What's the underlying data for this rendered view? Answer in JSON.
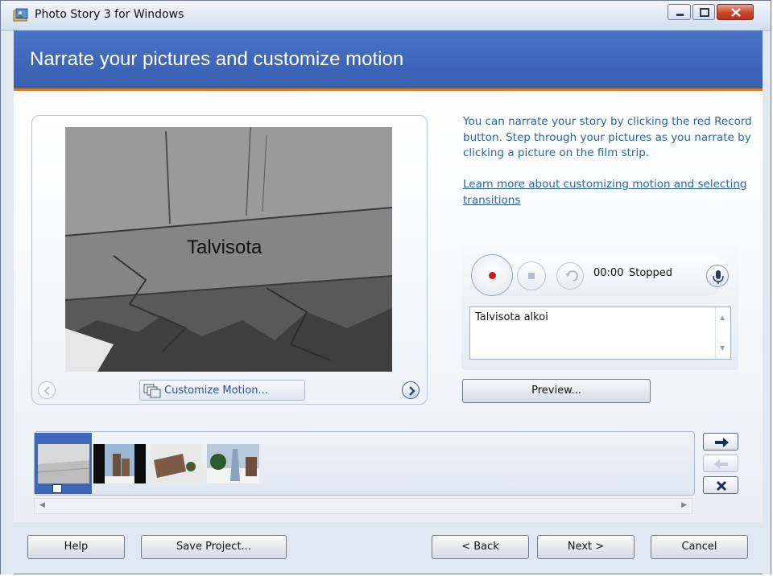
{
  "window": {
    "title": "Photo Story 3 for Windows",
    "icon": "photo-story-app-icon",
    "controls": [
      "minimize-icon",
      "maximize-icon",
      "close-icon"
    ],
    "close_color": "#c9452b"
  },
  "header": {
    "title": "Narrate your pictures and customize motion",
    "accent_color": "#e37a21",
    "background_color": "#3f67b9"
  },
  "preview": {
    "caption": "Talvisota",
    "prev_icon": "chevron-left-icon",
    "next_icon": "chevron-right-icon",
    "customize_label": "Customize Motion...",
    "customize_icon": "customize-motion-icon"
  },
  "info": {
    "text": "You can narrate your story by clicking the red Record button. Step through your pictures as you narrate by clicking a picture on the film strip.",
    "link": "Learn more about customizing motion and selecting transitions"
  },
  "recorder": {
    "time": "00:00",
    "status": "Stopped",
    "record_icon": "record-icon",
    "stop_icon": "stop-icon",
    "undo_icon": "undo-icon",
    "mic_icon": "microphone-icon",
    "notes_text": "Talvisota alkoi"
  },
  "preview_button": "Preview...",
  "filmstrip": {
    "selected_index": 0,
    "thumbnails": [
      "stone-wall-thumbnail",
      "memorial-statue-thumbnail",
      "memorial-plaque-thumbnail",
      "monument-snow-thumbnail"
    ],
    "side_buttons": [
      "move-right-arrow-icon",
      "move-left-arrow-icon",
      "delete-x-icon"
    ]
  },
  "bottom_buttons": {
    "help": "Help",
    "save": "Save Project...",
    "back": "< Back",
    "next": "Next >",
    "cancel": "Cancel"
  }
}
